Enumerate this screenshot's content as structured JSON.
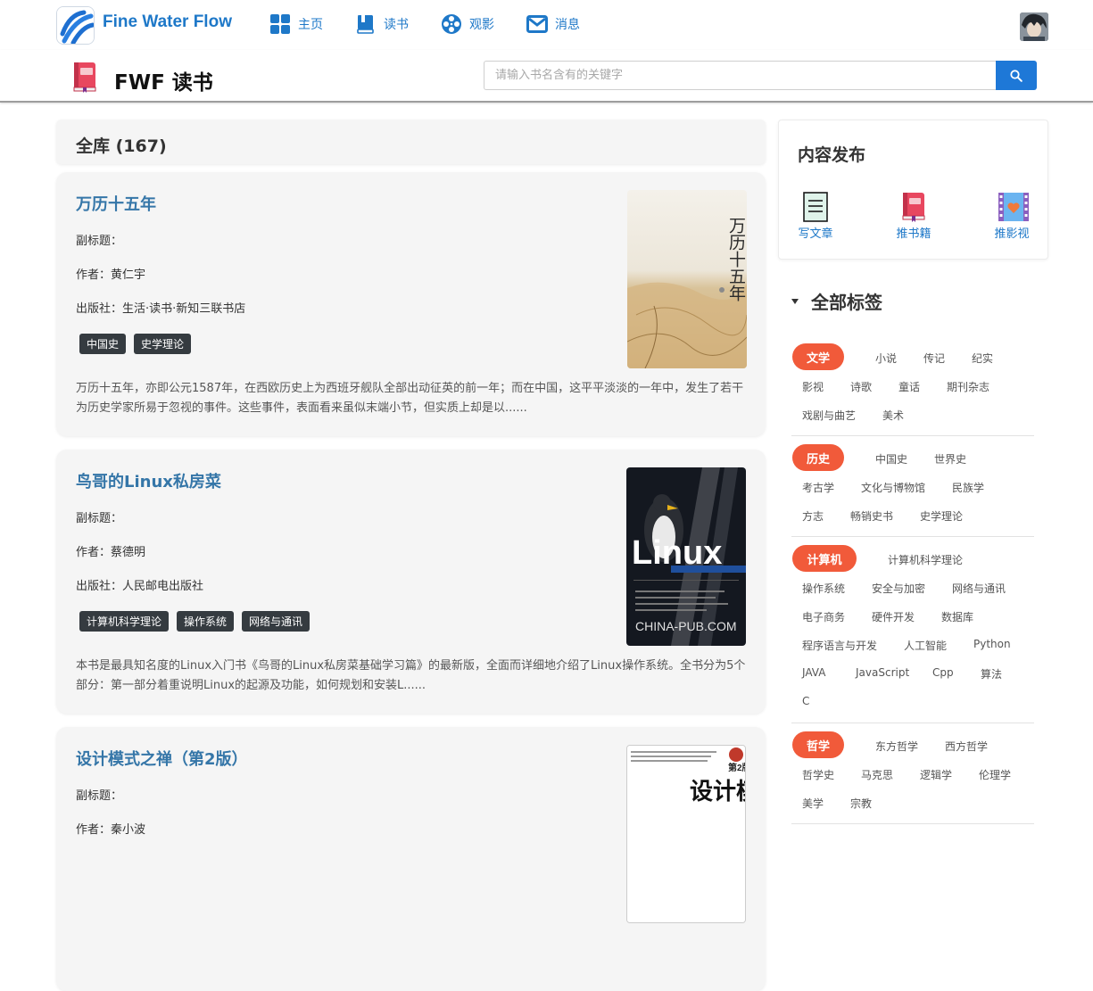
{
  "nav": {
    "brand": "Fine Water Flow",
    "items": [
      {
        "label": "主页",
        "icon": "grid-icon"
      },
      {
        "label": "读书",
        "icon": "book-icon"
      },
      {
        "label": "观影",
        "icon": "film-reel-icon"
      },
      {
        "label": "消息",
        "icon": "mail-icon"
      }
    ]
  },
  "subheader": {
    "title": "FWF 读书",
    "search_placeholder": "请输入书名含有的关键字"
  },
  "library": {
    "header": "全库 (167)"
  },
  "books": [
    {
      "title": "万历十五年",
      "subtitle": "副标题：",
      "author": "作者：黄仁宇",
      "publisher": "出版社：生活·读书·新知三联书店",
      "tags": [
        "中国史",
        "史学理论"
      ],
      "desc": "万历十五年，亦即公元1587年，在西欧历史上为西班牙舰队全部出动征英的前一年；而在中国，这平平淡淡的一年中，发生了若干为历史学家所易于忽视的事件。这些事件，表面看来虽似末端小节，但实质上却是以......",
      "cover_text": "万历十五年"
    },
    {
      "title": "鸟哥的Linux私房菜",
      "subtitle": "副标题：",
      "author": "作者：蔡德明",
      "publisher": "出版社：人民邮电出版社",
      "tags": [
        "计算机科学理论",
        "操作系统",
        "网络与通讯"
      ],
      "desc": "本书是最具知名度的Linux入门书《鸟哥的Linux私房菜基础学习篇》的最新版，全面而详细地介绍了Linux操作系统。全书分为5个部分：第一部分着重说明Linux的起源及功能，如何规划和安装L......",
      "cover_text": "Linux",
      "cover_sub": "CHINA-PUB.COM"
    },
    {
      "title": "设计模式之禅（第2版）",
      "subtitle": "副标题：",
      "author": "作者：秦小波",
      "cover_text": "设计模式"
    }
  ],
  "publish": {
    "title": "内容发布",
    "items": [
      {
        "label": "写文章",
        "icon": "write-article-icon"
      },
      {
        "label": "推书籍",
        "icon": "recommend-book-icon"
      },
      {
        "label": "推影视",
        "icon": "recommend-film-icon"
      }
    ]
  },
  "all_tags": {
    "title": "全部标签",
    "groups": [
      {
        "category": "文学",
        "tags": [
          "小说",
          "传记",
          "纪实",
          "影视",
          "诗歌",
          "童话",
          "期刊杂志",
          "戏剧与曲艺",
          "美术"
        ]
      },
      {
        "category": "历史",
        "tags": [
          "中国史",
          "世界史",
          "考古学",
          "文化与博物馆",
          "民族学",
          "方志",
          "畅销史书",
          "史学理论"
        ]
      },
      {
        "category": "计算机",
        "tags": [
          "计算机科学理论",
          "操作系统",
          "安全与加密",
          "网络与通讯",
          "电子商务",
          "硬件开发",
          "数据库",
          "程序语言与开发",
          "人工智能",
          "Python",
          "JAVA",
          "JavaScript",
          "Cpp",
          "算法",
          "C"
        ]
      },
      {
        "category": "哲学",
        "tags": [
          "东方哲学",
          "西方哲学",
          "哲学史",
          "马克思",
          "逻辑学",
          "伦理学",
          "美学",
          "宗教"
        ]
      }
    ]
  },
  "colors": {
    "brand_blue": "#1e78c8",
    "category_orange": "#f15a3a",
    "tag_dark": "#353b40"
  }
}
